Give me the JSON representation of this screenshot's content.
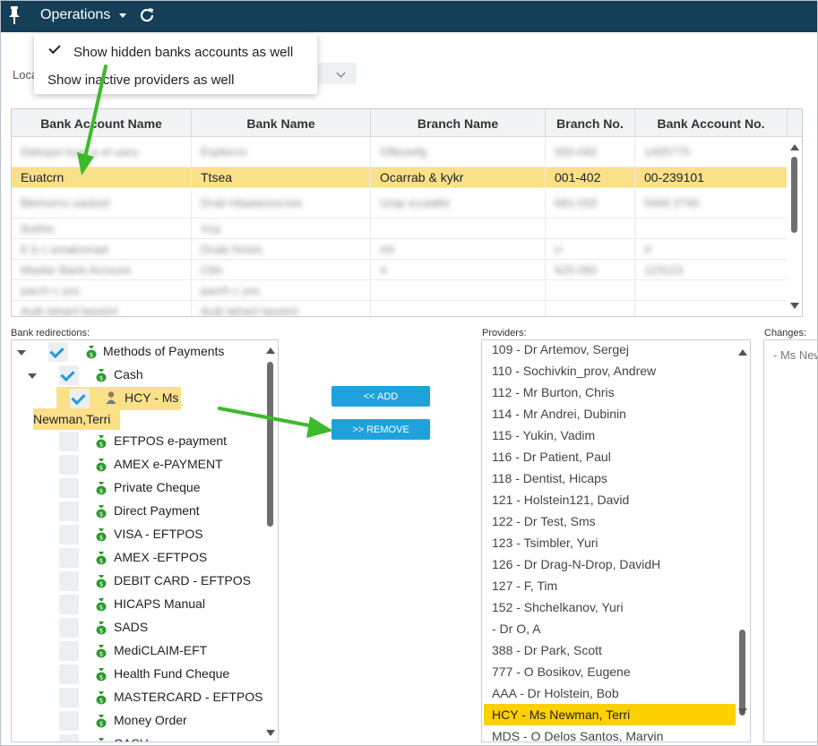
{
  "toolbar": {
    "operations_label": "Operations",
    "menu_items": [
      {
        "label": "Show hidden banks accounts as well",
        "checked": true
      },
      {
        "label": "Show inactive providers as well",
        "checked": false
      }
    ]
  },
  "location": {
    "label": "Loca"
  },
  "grid": {
    "columns": [
      "Bank Account Name",
      "Bank Name",
      "Branch Name",
      "Branch No.",
      "Bank Account No."
    ],
    "rows": [
      {
        "cells": [
          "Dalxqun kxar p et uaru",
          "Esptecro",
          "Ofticeefg",
          "050-042",
          "1405775"
        ],
        "blurred": true
      },
      {
        "cells": [
          "Euatcrn",
          "Ttsea",
          "Ocarrab & kykr",
          "001-402",
          "00-239101"
        ],
        "blurred": false,
        "selected": true
      },
      {
        "cells": [
          "Blemorvx uaxkxd",
          "Drab Htaawoxxcrex",
          "Urap ecutafer",
          "681-032",
          "0466 2740"
        ],
        "blurred": true
      },
      {
        "cells": [
          "Ibxthix",
          "Vsa",
          "",
          "",
          ""
        ],
        "blurred": true
      },
      {
        "cells": [
          "E b c emaknmad",
          "Dnab Hcton",
          "rtrt",
          "rr",
          "rr"
        ],
        "blurred": true
      },
      {
        "cells": [
          "Master Bank Account",
          "Cbh",
          "rr",
          "625-092",
          "123123"
        ],
        "blurred": true
      },
      {
        "cells": [
          "pacrh c yss",
          "pacrh c yss",
          "",
          "",
          ""
        ],
        "blurred": true
      },
      {
        "cells": [
          "Auib lahanl lasoiml",
          "Auib lahanl lasoiml",
          "",
          "",
          ""
        ],
        "blurred": true
      }
    ]
  },
  "labels": {
    "bank_redirections": "Bank redirections:",
    "providers": "Providers:",
    "changes": "Changes:"
  },
  "tree": {
    "root": {
      "label": "Methods of Payments"
    },
    "cash": {
      "label": "Cash"
    },
    "hcy_line1": "HCY - Ms",
    "hcy_line2": "Newman,Terri",
    "methods": [
      "EFTPOS e-payment",
      "AMEX e-PAYMENT",
      "Private Cheque",
      "Direct Payment",
      "VISA - EFTPOS",
      "AMEX -EFTPOS",
      "DEBIT CARD - EFTPOS",
      "HICAPS Manual",
      "SADS",
      "MediCLAIM-EFT",
      "Health Fund Cheque",
      "MASTERCARD - EFTPOS",
      "Money Order",
      "CASH"
    ]
  },
  "buttons": {
    "add": "<< ADD",
    "remove": ">> REMOVE"
  },
  "providers": [
    "109 - Dr Artemov, Sergej",
    "110 -  Sochivkin_prov, Andrew",
    "112 - Mr Burton, Chris",
    "114 - Mr Andrei, Dubinin",
    "115 -  Yukin, Vadim",
    "116 - Dr Patient, Paul",
    "118 -  Dentist, Hicaps",
    "121 -  Holstein121, David",
    "122 - Dr Test, Sms",
    "123 -  Tsimbler, Yuri",
    "126 - Dr Drag-N-Drop, DavidH",
    "127 -  F, Tim",
    "152 -  Shchelkanov, Yuri",
    " - Dr O, A",
    "388 - Dr Park, Scott",
    "777 - O Bosikov, Eugene",
    "AAA - Dr Holstein, Bob",
    "HCY - Ms Newman, Terri",
    "MDS - O Delos Santos, Marvin"
  ],
  "providers_selected_index": 17,
  "changes": {
    "items": [
      "- Ms Newman, Terri"
    ]
  },
  "colors": {
    "topbar": "#143f56",
    "selected_row": "#fbe08a",
    "selected_provider": "#fdd000",
    "button": "#1fa2dc",
    "check": "#1f9bd8",
    "arrow": "#3cba2a",
    "bag": "#2e9a2e"
  },
  "icons": [
    "pin-icon",
    "caret-down-icon",
    "refresh-icon",
    "check-icon",
    "money-bag-icon",
    "person-icon",
    "scroll-up-icon",
    "scroll-down-icon"
  ]
}
